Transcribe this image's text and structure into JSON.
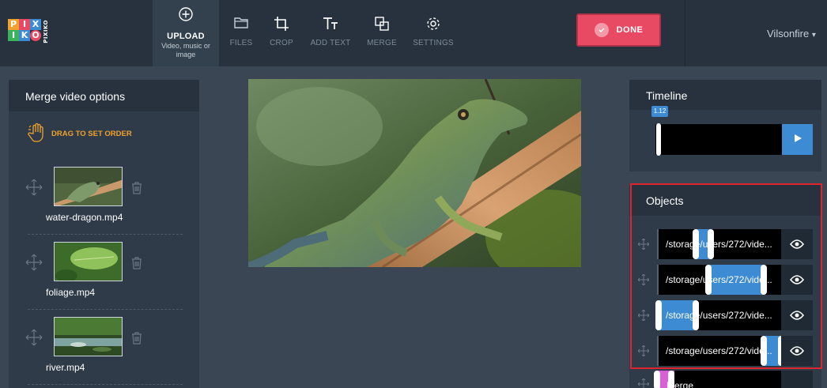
{
  "app": {
    "logo_letters": [
      "PI",
      "XI",
      "KO"
    ],
    "logo_vertical": "PIXIKO",
    "user_name": "Vilsonfire",
    "user_caret": "▾",
    "done_label": "DONE"
  },
  "toolbar": [
    {
      "label": "UPLOAD",
      "sub": "Video, music or image",
      "icon": "plus-circle-icon",
      "active": true
    },
    {
      "label": "FILES",
      "icon": "folder-icon"
    },
    {
      "label": "CROP",
      "icon": "crop-icon"
    },
    {
      "label": "ADD TEXT",
      "icon": "text-icon"
    },
    {
      "label": "MERGE",
      "icon": "merge-icon"
    },
    {
      "label": "SETTINGS",
      "icon": "gear-icon"
    }
  ],
  "merge_panel": {
    "title": "Merge video options",
    "drag_hint": "DRAG TO SET ORDER",
    "items": [
      {
        "name": "water-dragon.mp4"
      },
      {
        "name": "foliage.mp4"
      },
      {
        "name": "river.mp4"
      }
    ]
  },
  "timeline": {
    "title": "Timeline",
    "position": "1.12"
  },
  "objects": {
    "title": "Objects",
    "rows": [
      {
        "path": "/storage/users/272/vide...",
        "seg_start": 0.3,
        "seg_end": 0.42
      },
      {
        "path": "/storage/users/272/vide...",
        "seg_start": 0.4,
        "seg_end": 0.85
      },
      {
        "path": "/storage/users/272/vide...",
        "seg_start": 0.0,
        "seg_end": 0.3
      },
      {
        "path": "/storage/users/272/vide...",
        "seg_start": 0.85,
        "seg_end": 1.0
      }
    ],
    "merge_label": "Merge"
  },
  "colors": {
    "accent": "#3d8bd3",
    "done": "#e84a63",
    "hint": "#f0a22e",
    "header": "#27323e",
    "background": "#3a4654"
  }
}
